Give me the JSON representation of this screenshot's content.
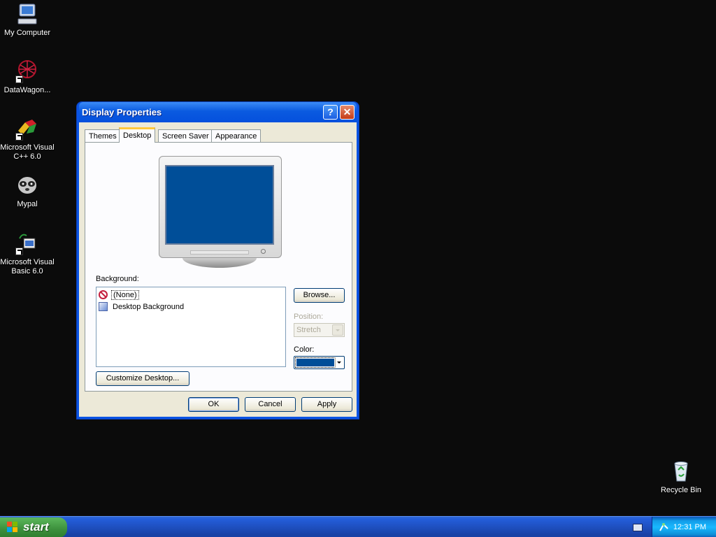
{
  "desktop": {
    "icons": [
      {
        "label": "My Computer"
      },
      {
        "label": "DataWagon..."
      },
      {
        "label": "Microsoft Visual C++ 6.0"
      },
      {
        "label": "Mypal"
      },
      {
        "label": "Microsoft Visual Basic 6.0"
      },
      {
        "label": "Recycle Bin"
      }
    ]
  },
  "dialog": {
    "title": "Display Properties",
    "help_symbol": "?",
    "close_symbol": "✕",
    "tabs": [
      {
        "label": "Themes"
      },
      {
        "label": "Desktop"
      },
      {
        "label": "Screen Saver"
      },
      {
        "label": "Appearance"
      }
    ],
    "active_tab": "Desktop",
    "background_label": "Background:",
    "background_items": [
      {
        "label": "(None)",
        "icon": "no-entry-icon"
      },
      {
        "label": "Desktop Background",
        "icon": "image-file-icon"
      }
    ],
    "browse_label": "Browse...",
    "position_label": "Position:",
    "position_value": "Stretch",
    "color_label": "Color:",
    "color_value": "#004e98",
    "customize_label": "Customize Desktop...",
    "ok_label": "OK",
    "cancel_label": "Cancel",
    "apply_label": "Apply"
  },
  "taskbar": {
    "start_label": "start",
    "clock": "12:31 PM"
  }
}
